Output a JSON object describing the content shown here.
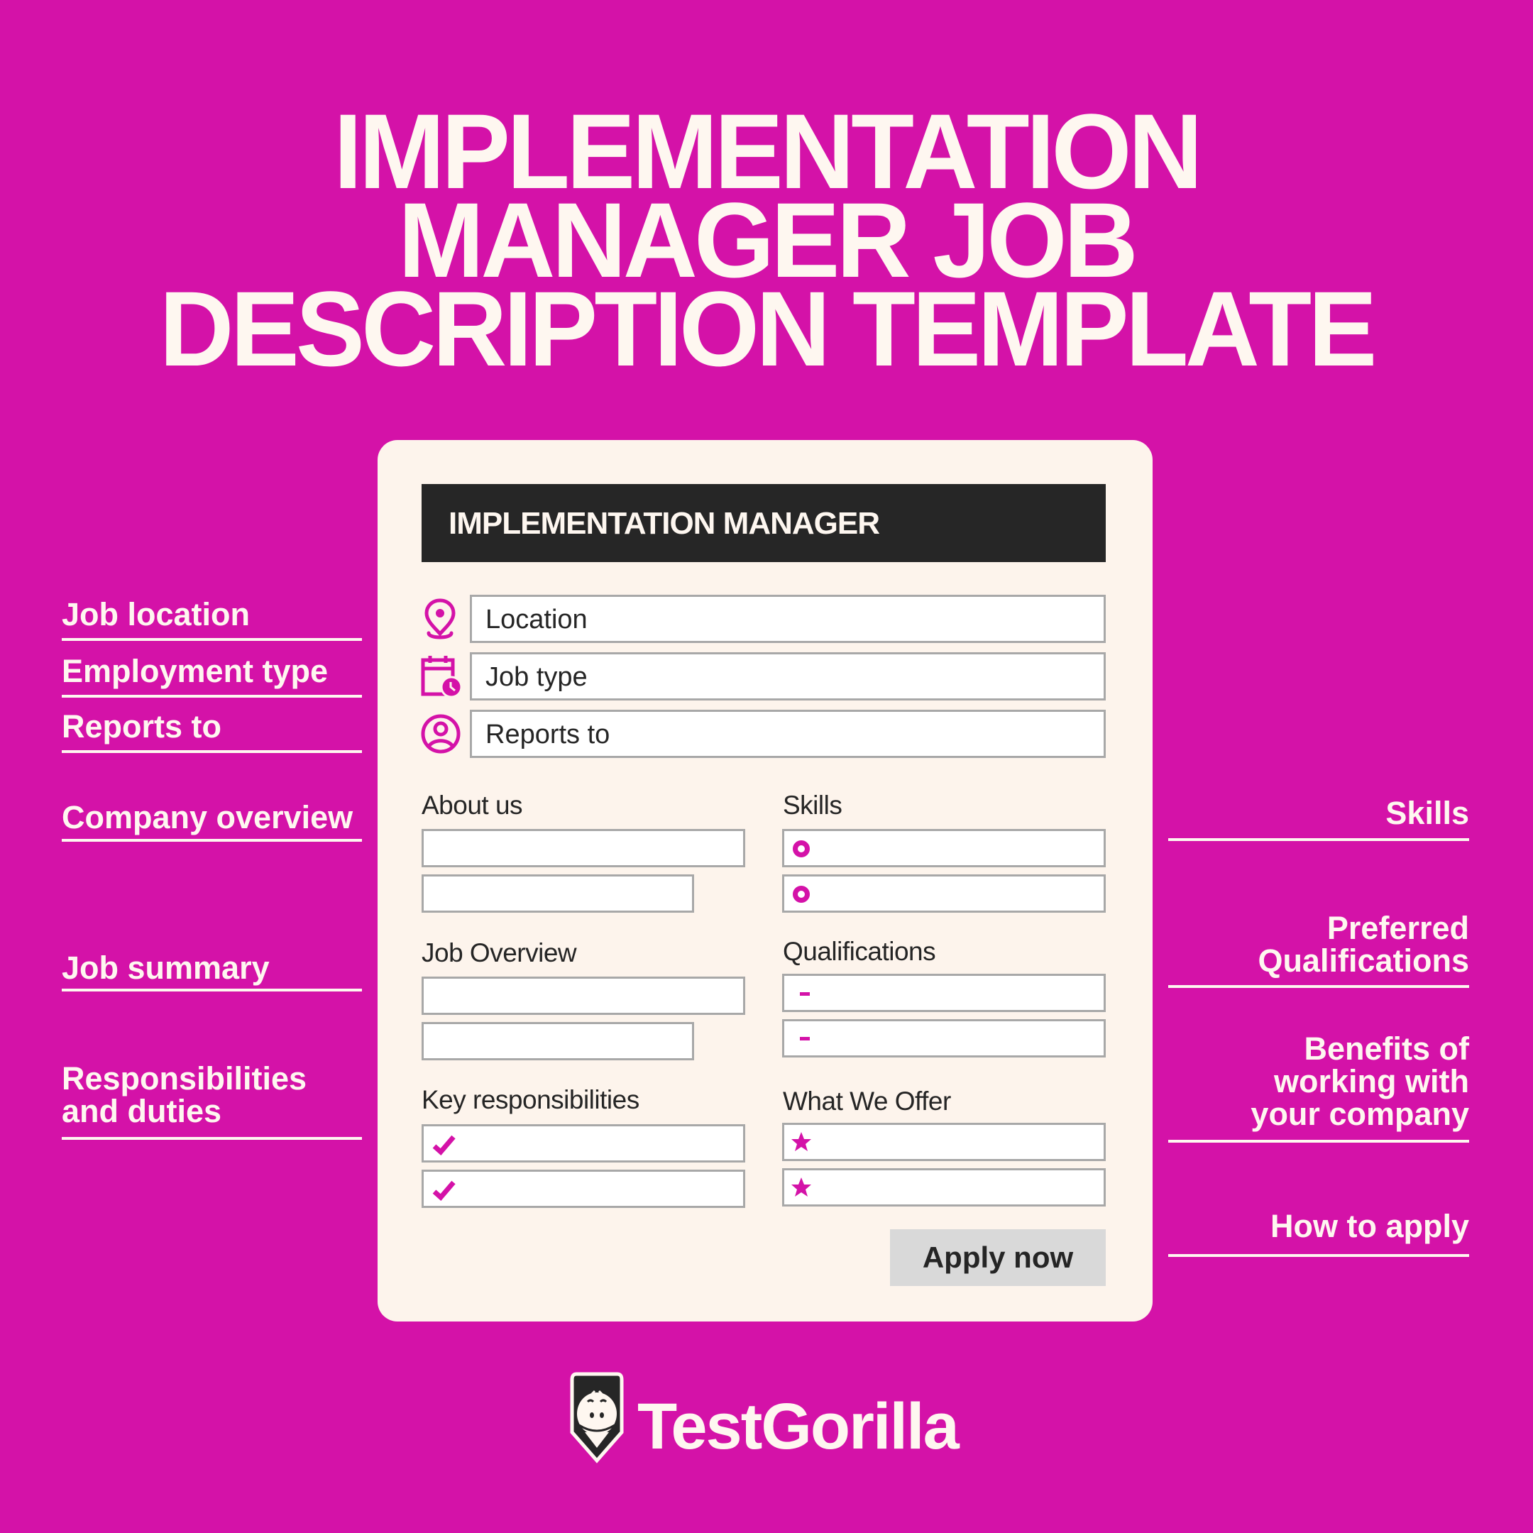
{
  "title": {
    "line1": "IMPLEMENTATION",
    "line2": "MANAGER JOB",
    "line3": "DESCRIPTION TEMPLATE"
  },
  "colors": {
    "background": "#D412A8",
    "card": "#FDF4EC",
    "header_bar": "#262626",
    "accent": "#D412A8",
    "text_light": "#FEF7F0",
    "text_dark": "#252525",
    "field_border": "#A8A8A8",
    "button": "#D9D9D9"
  },
  "card": {
    "header": "IMPLEMENTATION MANAGER",
    "fields": [
      {
        "icon": "location-pin-icon",
        "value": "Location"
      },
      {
        "icon": "calendar-clock-icon",
        "value": "Job type"
      },
      {
        "icon": "user-circle-icon",
        "value": "Reports to"
      }
    ],
    "sections": {
      "about_us": {
        "label": "About us"
      },
      "skills": {
        "label": "Skills",
        "marker": "ring-bullet-icon"
      },
      "job_overview": {
        "label": "Job Overview"
      },
      "qualifications": {
        "label": "Qualifications",
        "marker": "dash-icon"
      },
      "key_responsibilities": {
        "label": "Key responsibilities",
        "marker": "checkmark-icon"
      },
      "what_we_offer": {
        "label": "What We Offer",
        "marker": "star-icon"
      }
    },
    "apply_button": "Apply now"
  },
  "left_annotations": [
    "Job location",
    "Employment type",
    "Reports to",
    "Company overview",
    "Job summary",
    "Responsibilities and duties"
  ],
  "right_annotations": [
    "Skills",
    "Preferred Qualifications",
    "Benefits of working with your company",
    "How to apply"
  ],
  "brand": {
    "name": "TestGorilla",
    "logo_icon": "gorilla-shield-icon"
  }
}
